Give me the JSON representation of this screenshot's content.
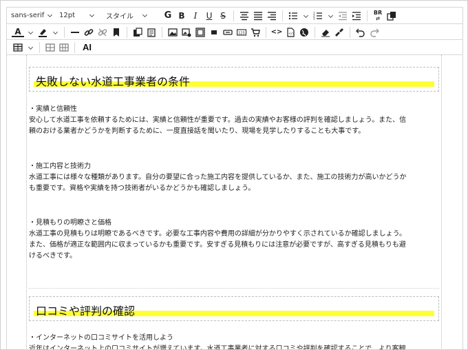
{
  "toolbar": {
    "font_family": "sans-serif",
    "font_size": "12pt",
    "style": "スタイル",
    "ai_label": "AI",
    "icons": [
      "bold-g-icon",
      "bold-icon",
      "italic-icon",
      "underline-icon",
      "strikethrough-icon",
      "align-center-icon",
      "align-left-icon",
      "align-right-icon",
      "bullet-list-icon",
      "numbered-list-icon",
      "outdent-icon",
      "indent-icon",
      "text-direction-icon",
      "copy-format-icon"
    ]
  },
  "article": {
    "heading1": "失敗しない水道工事業者の条件",
    "sections": [
      {
        "title": "・実績と信頼性",
        "line1": "安心して水道工事を依頼するためには、実績と信頼性が重要です。過去の実績やお客様の評判を確認しましょう。また、信",
        "line2": "頼のおける業者かどうかを判断するために、一度直接話を聞いたり、現場を見学したりすることも大事です。"
      },
      {
        "title": "・施工内容と技術力",
        "line1": "水道工事には様々な種類があります。自分の要望に合った施工内容を提供しているか、また、施工の技術力が高いかどうか",
        "line2": "も重要です。資格や実績を持つ技術者がいるかどうかも確認しましょう。"
      },
      {
        "title": "・見積もりの明瞭さと価格",
        "line1": "水道工事の見積もりは明瞭であるべきです。必要な工事内容や費用の詳細が分かりやすく示されているか確認しましょう。",
        "line2": "また、価格が適正な範囲内に収まっているかも重要です。安すぎる見積もりには注意が必要ですが、高すぎる見積もりも避",
        "line3": "けるべきです。"
      }
    ],
    "heading2": "口コミや評判の確認",
    "section4_title": "・インターネットの口コミサイトを活用しよう",
    "section4_line1": "近年はインターネット上の口コミサイトが増えています。水道工事業者に対する口コミや評判を確認することで、より客観"
  }
}
